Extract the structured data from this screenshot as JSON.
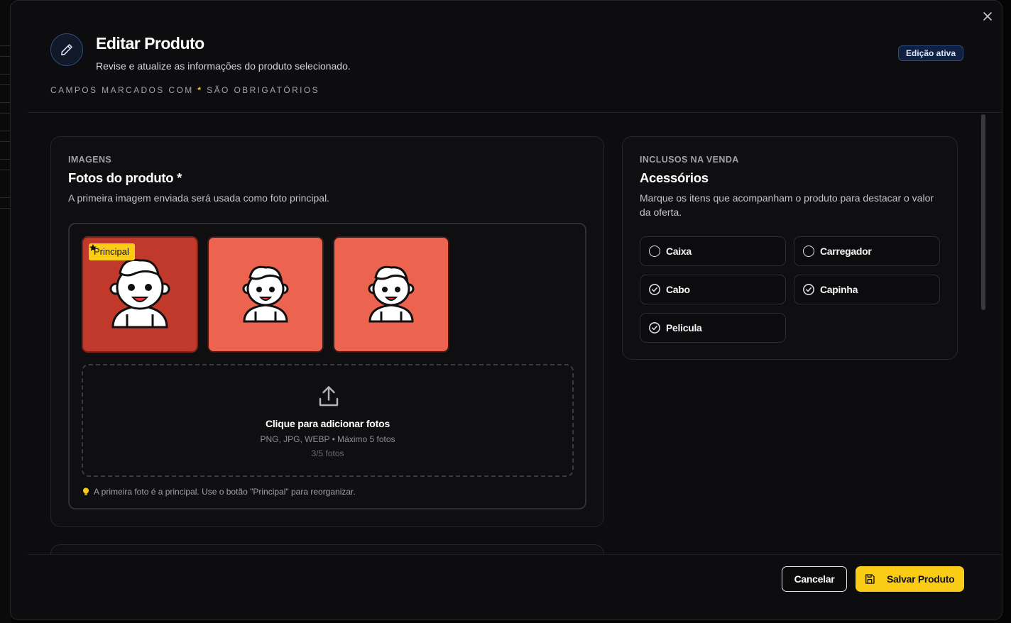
{
  "modal": {
    "title": "Editar Produto",
    "subtitle": "Revise e atualize as informações do produto selecionado.",
    "required_note_prefix": "CAMPOS MARCADOS COM",
    "required_note_star": "*",
    "required_note_suffix": "SÃO OBRIGATÓRIOS",
    "status_badge": "Edição ativa",
    "close_icon": "close-icon",
    "header_icon": "pencil-icon"
  },
  "images_card": {
    "eyebrow": "IMAGENS",
    "title": "Fotos do produto *",
    "description": "A primeira imagem enviada será usada como foto principal.",
    "photos": [
      {
        "badge": "Principal",
        "is_main": true
      },
      {
        "badge": "",
        "is_main": false
      },
      {
        "badge": "",
        "is_main": false
      }
    ],
    "dropzone": {
      "icon": "upload-icon",
      "title": "Clique para adicionar fotos",
      "formats": "PNG, JPG, WEBP • Máximo 5 fotos",
      "count": "3/5 fotos"
    },
    "tip": "A primeira foto é a principal. Use o botão \"Principal\" para reorganizar."
  },
  "accessories_card": {
    "eyebrow": "INCLUSOS NA VENDA",
    "title": "Acessórios",
    "description": "Marque os itens que acompanham o produto para destacar o valor da oferta.",
    "items": [
      {
        "label": "Caixa",
        "checked": false
      },
      {
        "label": "Carregador",
        "checked": false
      },
      {
        "label": "Cabo",
        "checked": true
      },
      {
        "label": "Capinha",
        "checked": true
      },
      {
        "label": "Pelicula",
        "checked": true
      }
    ]
  },
  "footer": {
    "cancel_label": "Cancelar",
    "save_label": "Salvar Produto",
    "save_icon": "save-icon"
  },
  "colors": {
    "accent": "#facc15",
    "badge_bg": "#10213f",
    "photo_main": "#c0392b",
    "photo": "#ec6350"
  }
}
